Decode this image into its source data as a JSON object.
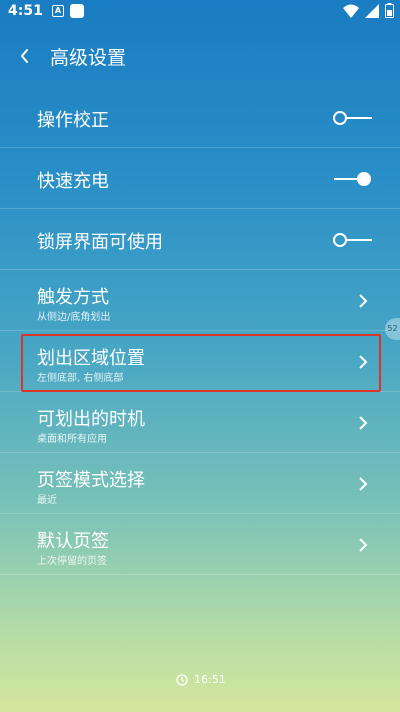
{
  "status_bar": {
    "time": "4:51",
    "notif_letter": "A",
    "icons": [
      "a-notification-icon",
      "square-notification-icon",
      "wifi-icon",
      "signal-icon",
      "battery-icon"
    ]
  },
  "header": {
    "title": "高级设置",
    "back_icon": "back-arrow-icon"
  },
  "settings": [
    {
      "label": "操作校正",
      "control": "toggle",
      "on": false
    },
    {
      "label": "快速充电",
      "control": "toggle",
      "on": true
    },
    {
      "label": "锁屏界面可使用",
      "control": "toggle",
      "on": false
    },
    {
      "label": "触发方式",
      "sub": "从侧边/底角划出",
      "control": "chevron"
    },
    {
      "label": "划出区域位置",
      "sub": "左侧底部, 右侧底部",
      "control": "chevron",
      "highlighted": true
    },
    {
      "label": "可划出的时机",
      "sub": "桌面和所有应用",
      "control": "chevron"
    },
    {
      "label": "页签模式选择",
      "sub": "最近",
      "control": "chevron"
    },
    {
      "label": "默认页签",
      "sub": "上次停留的页签",
      "control": "chevron"
    }
  ],
  "edge_tab_label": "52",
  "footer": {
    "time": "16:51",
    "icon": "clock-icon"
  },
  "colors": {
    "highlight": "#d9352b",
    "text": "#ffffff",
    "gradient_top": "#1a7cc2",
    "gradient_bottom": "#d4e69c"
  }
}
